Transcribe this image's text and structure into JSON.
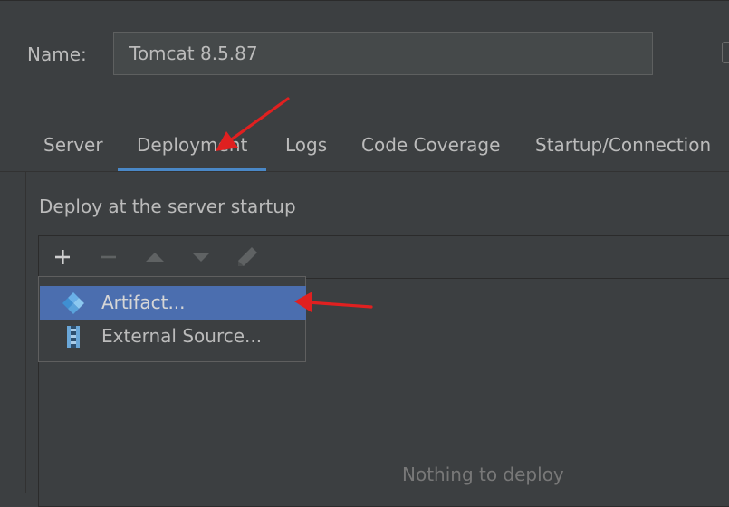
{
  "name_field": {
    "label": "Name:",
    "value": "Tomcat 8.5.87"
  },
  "tabs": [
    {
      "label": "Server"
    },
    {
      "label": "Deployment",
      "active": true
    },
    {
      "label": "Logs"
    },
    {
      "label": "Code Coverage"
    },
    {
      "label": "Startup/Connection"
    }
  ],
  "deploy_section": {
    "title": "Deploy at the server startup",
    "empty_text": "Nothing to deploy",
    "toolbar": [
      "add-icon",
      "remove-icon",
      "move-up-icon",
      "move-down-icon",
      "edit-icon"
    ]
  },
  "add_popup": {
    "items": [
      {
        "label": "Artifact...",
        "icon": "artifact-icon",
        "selected": true
      },
      {
        "label": "External Source...",
        "icon": "external-source-icon",
        "selected": false
      }
    ]
  },
  "colors": {
    "background": "#3c3f41",
    "accent": "#4a88c7",
    "selection": "#4b6eaf",
    "annotation_arrow": "#e02020"
  }
}
